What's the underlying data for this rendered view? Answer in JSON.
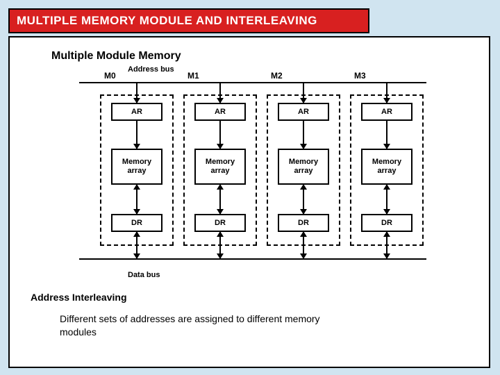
{
  "title": "MULTIPLE MEMORY MODULE AND INTERLEAVING",
  "heading1": "Multiple Module Memory",
  "address_bus_label": "Address bus",
  "data_bus_label": "Data bus",
  "modules": [
    {
      "label": "M0",
      "ar": "AR",
      "mem": "Memory array",
      "dr": "DR"
    },
    {
      "label": "M1",
      "ar": "AR",
      "mem": "Memory array",
      "dr": "DR"
    },
    {
      "label": "M2",
      "ar": "AR",
      "mem": "Memory array",
      "dr": "DR"
    },
    {
      "label": "M3",
      "ar": "AR",
      "mem": "Memory array",
      "dr": "DR"
    }
  ],
  "heading2": "Address Interleaving",
  "body_text": "Different sets of addresses are assigned to different memory modules"
}
